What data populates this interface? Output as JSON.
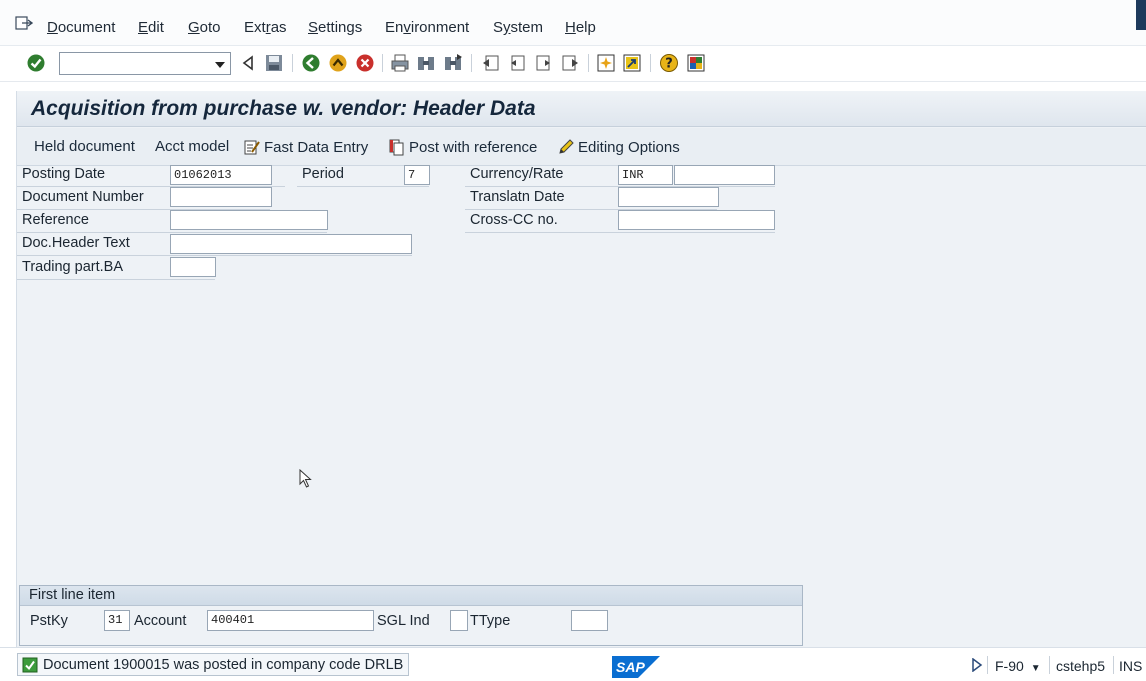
{
  "menubar": {
    "items": [
      {
        "label": "Document",
        "ul": "D"
      },
      {
        "label": "Edit",
        "ul": "E"
      },
      {
        "label": "Goto",
        "ul": "G"
      },
      {
        "label": "Extras",
        "ul": "r"
      },
      {
        "label": "Settings",
        "ul": "S"
      },
      {
        "label": "Environment",
        "ul": "v"
      },
      {
        "label": "System",
        "ul": "y"
      },
      {
        "label": "Help",
        "ul": "H"
      }
    ]
  },
  "toolbar": {
    "command_value": "",
    "icons": [
      "enter-icon",
      "back-nav-icon",
      "save-icon",
      "back-icon",
      "exit-icon",
      "cancel-icon",
      "print-icon",
      "find-icon",
      "find-next-icon",
      "first-page-icon",
      "previous-page-icon",
      "next-page-icon",
      "last-page-icon",
      "create-session-icon",
      "shortcut-icon",
      "help-icon",
      "customize-layout-icon"
    ]
  },
  "screen": {
    "title": "Acquisition from purchase w. vendor: Header Data"
  },
  "app_toolbar": {
    "held_document": "Held document",
    "acct_model": "Acct model",
    "fast_data_entry": "Fast Data Entry",
    "post_with_reference": "Post with reference",
    "editing_options": "Editing Options"
  },
  "header": {
    "posting_date_label": "Posting Date",
    "posting_date_value": "01062013",
    "period_label": "Period",
    "period_value": "7",
    "currency_rate_label": "Currency/Rate",
    "currency_value": "INR",
    "rate_value": "",
    "document_number_label": "Document Number",
    "document_number_value": "",
    "translatn_date_label": "Translatn Date",
    "translatn_date_value": "",
    "reference_label": "Reference",
    "reference_value": "",
    "cross_cc_label": "Cross-CC no.",
    "cross_cc_value": "",
    "doc_header_text_label": "Doc.Header Text",
    "doc_header_text_value": "",
    "trading_part_ba_label": "Trading part.BA",
    "trading_part_ba_value": ""
  },
  "first_line_item": {
    "title": "First line item",
    "pstky_label": "PstKy",
    "pstky_value": "31",
    "account_label": "Account",
    "account_value": "400401",
    "sgl_ind_label": "SGL Ind",
    "sgl_ind_value": "",
    "ttype_label": "TType",
    "ttype_value": ""
  },
  "status": {
    "message": "Document 1900015 was posted in company code DRLB",
    "transaction": "F-90",
    "server": "cstehp5",
    "mode": "INS",
    "logo_text": "SAP"
  },
  "colors": {
    "status_success": "#3c9b3c",
    "title_text": "#15273c",
    "sap_logo_blue": "#0a6ed1"
  }
}
